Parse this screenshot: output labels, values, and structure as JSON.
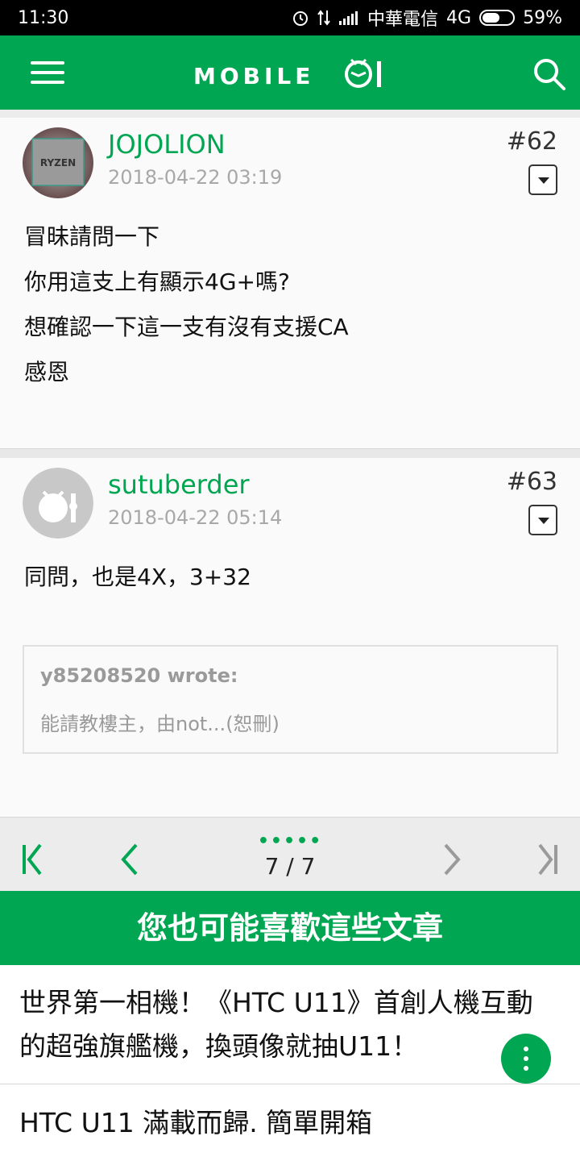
{
  "status_bar": {
    "time": "11:30",
    "carrier": "中華電信",
    "network": "4G",
    "battery": "59%",
    "battery_level": 0.59
  },
  "app_bar": {
    "logo_text": "MOBILE01",
    "menu_icon": "hamburger-icon",
    "search_icon": "search-icon"
  },
  "posts": [
    {
      "username": "JOJOLION",
      "timestamp": "2018-04-22 03:19",
      "floor": "#62",
      "avatar_label": "RYZEN",
      "lines": [
        "冒昧請問一下",
        "你用這支上有顯示4G+嗎?",
        "想確認一下這一支有沒有支援CA",
        "感恩"
      ]
    },
    {
      "username": "sutuberder",
      "timestamp": "2018-04-22 05:14",
      "floor": "#63",
      "lines": [
        "同問，也是4X，3+32"
      ],
      "quote": {
        "author": "y85208520 wrote:",
        "excerpt": "能請教樓主，由not...(恕刪)"
      }
    }
  ],
  "pager": {
    "page_label": "7 / 7",
    "dots": "•••••"
  },
  "related": {
    "header": "您也可能喜歡這些文章",
    "articles": [
      {
        "title_line1": "世界第一相機！《HTC U11》首創人機互動",
        "title_line2": "的超強旗艦機，換頭像就抽U11！"
      },
      {
        "title_line1": "HTC U11 滿載而歸.  簡單開箱"
      }
    ]
  },
  "colors": {
    "brand_green": "#00a651",
    "status_bar": "#000000"
  }
}
